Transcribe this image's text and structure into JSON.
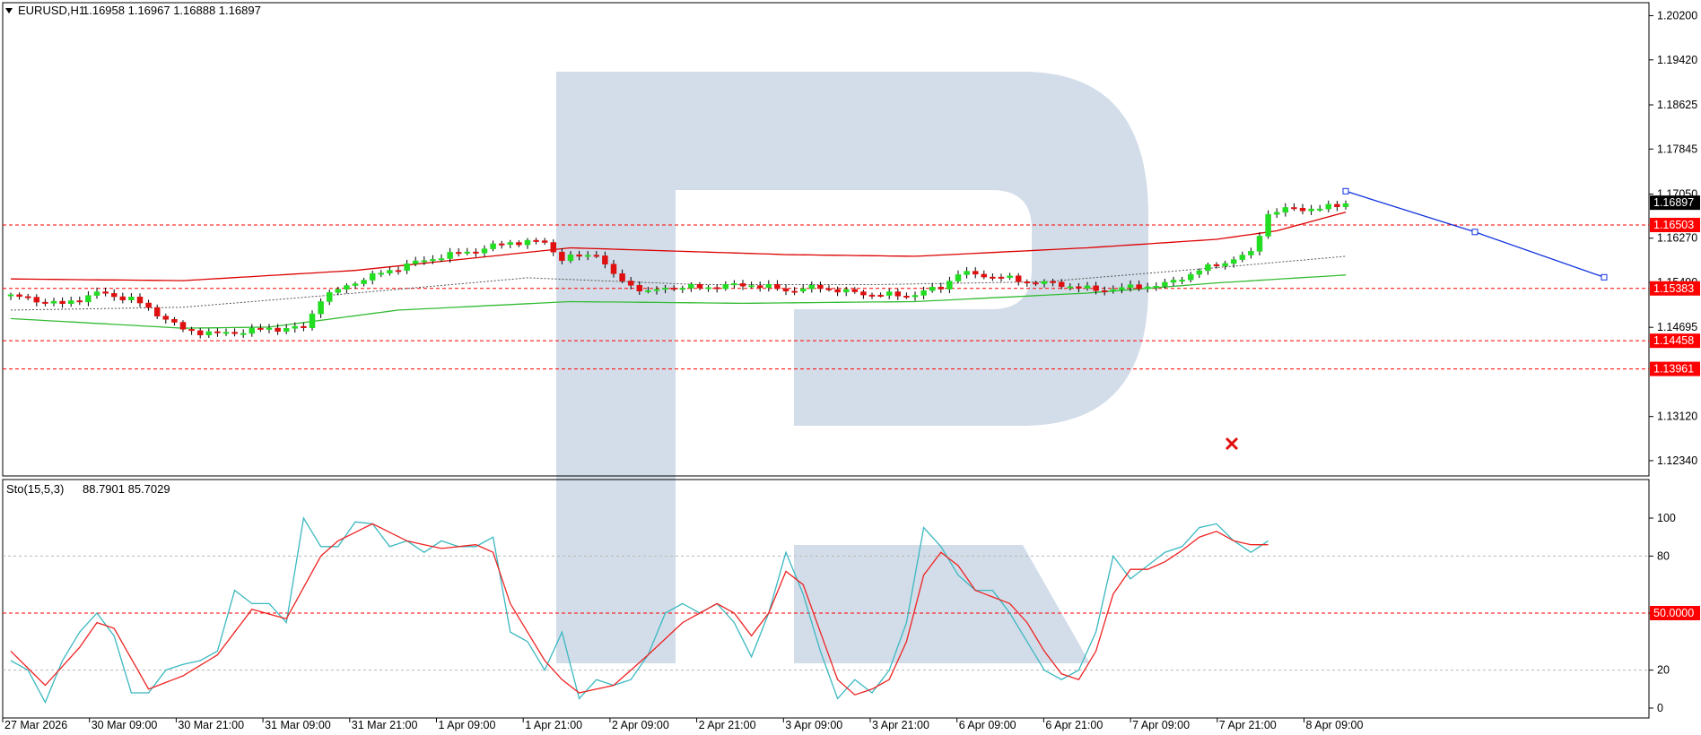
{
  "main_panel": {
    "title": "EURUSD,H1",
    "ohlc": "1.16958 1.16967 1.16888 1.16897",
    "menu_arrow_icon": "triangle-down-icon"
  },
  "stoch_panel": {
    "title": "Sto(15,5,3)",
    "values": "88.7901 85.7029"
  },
  "watermark_icon": "R-logo-watermark",
  "marker_icon": "red-cross-icon",
  "colors": {
    "bull": "#22dd22",
    "bear": "#e01010",
    "level": "#ff0000",
    "ma_red": "#dd0000",
    "ma_green": "#33bb33",
    "forecast": "#1133dd",
    "stoch_main": "#3ab8c0",
    "stoch_signal": "#ee2222",
    "watermark": "#d3dde9"
  },
  "chart_data": [
    {
      "type": "candlestick",
      "symbol": "EURUSD",
      "timeframe": "H1",
      "y_ticks": [
        "1.20200",
        "1.19420",
        "1.18625",
        "1.17845",
        "1.17050",
        "1.16270",
        "1.15490",
        "1.14695",
        "1.13120",
        "1.12340"
      ],
      "ylim": [
        1.1207,
        1.2043
      ],
      "x_ticks": [
        "27 Mar 2026",
        "30 Mar 09:00",
        "30 Mar 21:00",
        "31 Mar 09:00",
        "31 Mar 21:00",
        "1 Apr 09:00",
        "1 Apr 21:00",
        "2 Apr 09:00",
        "2 Apr 21:00",
        "3 Apr 09:00",
        "3 Apr 21:00",
        "6 Apr 09:00",
        "6 Apr 21:00",
        "7 Apr 09:00",
        "7 Apr 21:00",
        "8 Apr 09:00"
      ],
      "current_price": "1.16897",
      "price_levels": [
        "1.16503",
        "1.15383",
        "1.14458",
        "1.13961"
      ],
      "close_path": [
        [
          0,
          1.1525
        ],
        [
          6,
          1.151
        ],
        [
          10,
          1.153
        ],
        [
          14,
          1.152
        ],
        [
          18,
          1.1485
        ],
        [
          20,
          1.1465
        ],
        [
          24,
          1.1458
        ],
        [
          30,
          1.1467
        ],
        [
          34,
          1.1468
        ],
        [
          36,
          1.152
        ],
        [
          40,
          1.155
        ],
        [
          42,
          1.156
        ],
        [
          46,
          1.158
        ],
        [
          50,
          1.1595
        ],
        [
          54,
          1.1605
        ],
        [
          58,
          1.162
        ],
        [
          62,
          1.162
        ],
        [
          64,
          1.159
        ],
        [
          68,
          1.16
        ],
        [
          70,
          1.156
        ],
        [
          74,
          1.153
        ],
        [
          76,
          1.154
        ],
        [
          80,
          1.154
        ],
        [
          86,
          1.1545
        ],
        [
          90,
          1.1535
        ],
        [
          94,
          1.154
        ],
        [
          98,
          1.153
        ],
        [
          104,
          1.1525
        ],
        [
          108,
          1.154
        ],
        [
          110,
          1.1565
        ],
        [
          114,
          1.156
        ],
        [
          118,
          1.155
        ],
        [
          122,
          1.1545
        ],
        [
          126,
          1.1535
        ],
        [
          130,
          1.154
        ],
        [
          134,
          1.1545
        ],
        [
          138,
          1.157
        ],
        [
          140,
          1.158
        ],
        [
          144,
          1.16
        ],
        [
          146,
          1.167
        ],
        [
          149,
          1.168
        ],
        [
          152,
          1.1678
        ],
        [
          155,
          1.169
        ]
      ],
      "ma_red": [
        [
          0,
          1.1555
        ],
        [
          20,
          1.1552
        ],
        [
          40,
          1.157
        ],
        [
          65,
          1.161
        ],
        [
          90,
          1.1598
        ],
        [
          105,
          1.1595
        ],
        [
          125,
          1.161
        ],
        [
          140,
          1.1625
        ],
        [
          147,
          1.164
        ],
        [
          155,
          1.1673
        ]
      ],
      "ma_green": [
        [
          0,
          1.1485
        ],
        [
          20,
          1.1468
        ],
        [
          30,
          1.147
        ],
        [
          45,
          1.15
        ],
        [
          65,
          1.1515
        ],
        [
          85,
          1.1512
        ],
        [
          105,
          1.1515
        ],
        [
          125,
          1.153
        ],
        [
          140,
          1.1548
        ],
        [
          155,
          1.1562
        ]
      ],
      "ma_dotted": [
        [
          0,
          1.15
        ],
        [
          20,
          1.1505
        ],
        [
          40,
          1.153
        ],
        [
          60,
          1.1557
        ],
        [
          80,
          1.1545
        ],
        [
          100,
          1.1545
        ],
        [
          120,
          1.155
        ],
        [
          140,
          1.1575
        ],
        [
          155,
          1.1595
        ]
      ],
      "forecast_line": [
        [
          155,
          1.171
        ],
        [
          170,
          1.1638
        ],
        [
          185,
          1.1558
        ]
      ],
      "forecast_label": ""
    },
    {
      "type": "line",
      "title": "Sto(15,5,3)",
      "y_ticks": [
        "100",
        "80",
        "50.0000",
        "20",
        "0"
      ],
      "ylim": [
        0,
        100
      ],
      "levels": [
        80,
        50,
        20
      ],
      "series": [
        {
          "name": "",
          "values": [
            [
              0,
              25
            ],
            [
              2,
              20
            ],
            [
              4,
              3
            ],
            [
              6,
              25
            ],
            [
              8,
              40
            ],
            [
              10,
              50
            ],
            [
              12,
              38
            ],
            [
              14,
              8
            ],
            [
              16,
              8
            ],
            [
              18,
              20
            ],
            [
              20,
              23
            ],
            [
              22,
              25
            ],
            [
              24,
              30
            ],
            [
              26,
              62
            ],
            [
              28,
              55
            ],
            [
              30,
              55
            ],
            [
              32,
              45
            ],
            [
              34,
              100
            ],
            [
              36,
              85
            ],
            [
              38,
              85
            ],
            [
              40,
              98
            ],
            [
              42,
              97
            ],
            [
              44,
              85
            ],
            [
              46,
              88
            ],
            [
              48,
              82
            ],
            [
              50,
              88
            ],
            [
              52,
              85
            ],
            [
              54,
              85
            ],
            [
              56,
              90
            ],
            [
              58,
              40
            ],
            [
              60,
              35
            ],
            [
              62,
              20
            ],
            [
              64,
              40
            ],
            [
              66,
              5
            ],
            [
              68,
              15
            ],
            [
              70,
              12
            ],
            [
              72,
              15
            ],
            [
              74,
              28
            ],
            [
              76,
              50
            ],
            [
              78,
              55
            ],
            [
              80,
              50
            ],
            [
              82,
              55
            ],
            [
              84,
              45
            ],
            [
              86,
              27
            ],
            [
              88,
              50
            ],
            [
              90,
              82
            ],
            [
              92,
              60
            ],
            [
              94,
              30
            ],
            [
              96,
              5
            ],
            [
              98,
              15
            ],
            [
              100,
              8
            ],
            [
              102,
              20
            ],
            [
              104,
              45
            ],
            [
              106,
              95
            ],
            [
              108,
              85
            ],
            [
              110,
              70
            ],
            [
              112,
              62
            ],
            [
              114,
              62
            ],
            [
              116,
              50
            ],
            [
              118,
              35
            ],
            [
              120,
              20
            ],
            [
              122,
              15
            ],
            [
              124,
              20
            ],
            [
              126,
              40
            ],
            [
              128,
              80
            ],
            [
              130,
              68
            ],
            [
              132,
              75
            ],
            [
              134,
              82
            ],
            [
              136,
              85
            ],
            [
              138,
              95
            ],
            [
              140,
              97
            ],
            [
              142,
              88
            ],
            [
              144,
              82
            ],
            [
              146,
              88
            ]
          ]
        },
        {
          "name": "",
          "values": [
            [
              0,
              30
            ],
            [
              4,
              12
            ],
            [
              8,
              32
            ],
            [
              10,
              45
            ],
            [
              12,
              42
            ],
            [
              16,
              10
            ],
            [
              20,
              17
            ],
            [
              24,
              28
            ],
            [
              28,
              52
            ],
            [
              32,
              47
            ],
            [
              36,
              80
            ],
            [
              38,
              88
            ],
            [
              42,
              97
            ],
            [
              46,
              88
            ],
            [
              50,
              84
            ],
            [
              54,
              86
            ],
            [
              56,
              82
            ],
            [
              58,
              55
            ],
            [
              62,
              25
            ],
            [
              64,
              15
            ],
            [
              66,
              8
            ],
            [
              70,
              12
            ],
            [
              74,
              28
            ],
            [
              78,
              45
            ],
            [
              82,
              55
            ],
            [
              84,
              50
            ],
            [
              86,
              38
            ],
            [
              88,
              50
            ],
            [
              90,
              72
            ],
            [
              92,
              65
            ],
            [
              94,
              40
            ],
            [
              96,
              15
            ],
            [
              98,
              7
            ],
            [
              100,
              10
            ],
            [
              102,
              15
            ],
            [
              104,
              35
            ],
            [
              106,
              70
            ],
            [
              108,
              82
            ],
            [
              110,
              75
            ],
            [
              112,
              62
            ],
            [
              116,
              55
            ],
            [
              118,
              45
            ],
            [
              120,
              30
            ],
            [
              122,
              18
            ],
            [
              124,
              15
            ],
            [
              126,
              30
            ],
            [
              128,
              60
            ],
            [
              130,
              73
            ],
            [
              132,
              73
            ],
            [
              134,
              77
            ],
            [
              136,
              83
            ],
            [
              138,
              90
            ],
            [
              140,
              93
            ],
            [
              142,
              88
            ],
            [
              144,
              86
            ],
            [
              146,
              86
            ]
          ]
        }
      ],
      "stoch_k": "88.7901",
      "stoch_d": "85.7029"
    }
  ]
}
